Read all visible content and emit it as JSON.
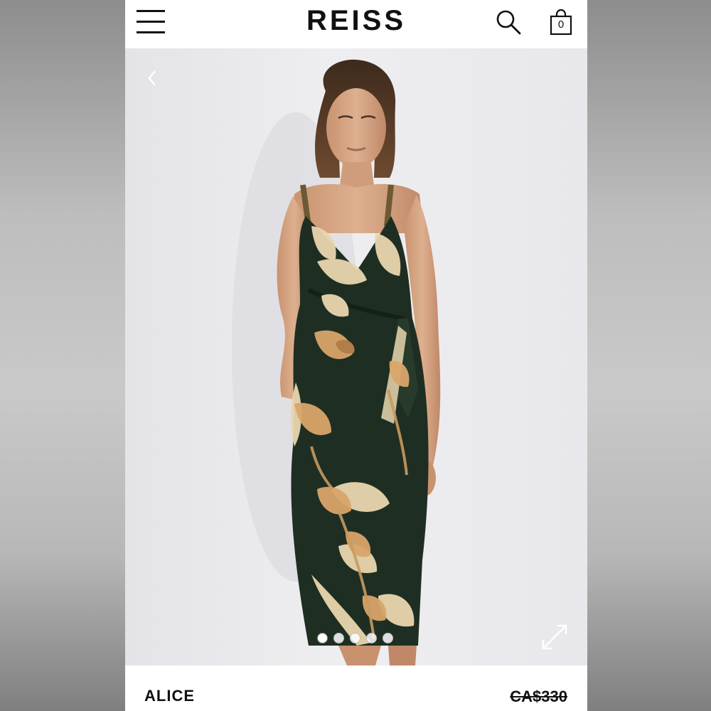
{
  "header": {
    "brand": "REISS",
    "bag_count": "0",
    "menu_icon": "hamburger-menu-icon",
    "search_icon": "search-icon",
    "bag_icon": "shopping-bag-icon"
  },
  "gallery": {
    "image_count": 5,
    "active_index": 0,
    "prev_icon": "chevron-left-icon",
    "expand_icon": "expand-icon"
  },
  "product": {
    "name": "ALICE",
    "price": "CA$330"
  },
  "colors": {
    "dress_green": "#1f2e22",
    "print_cream": "#e9d6ae",
    "print_tan": "#d9a56a",
    "background": "#ececef"
  }
}
